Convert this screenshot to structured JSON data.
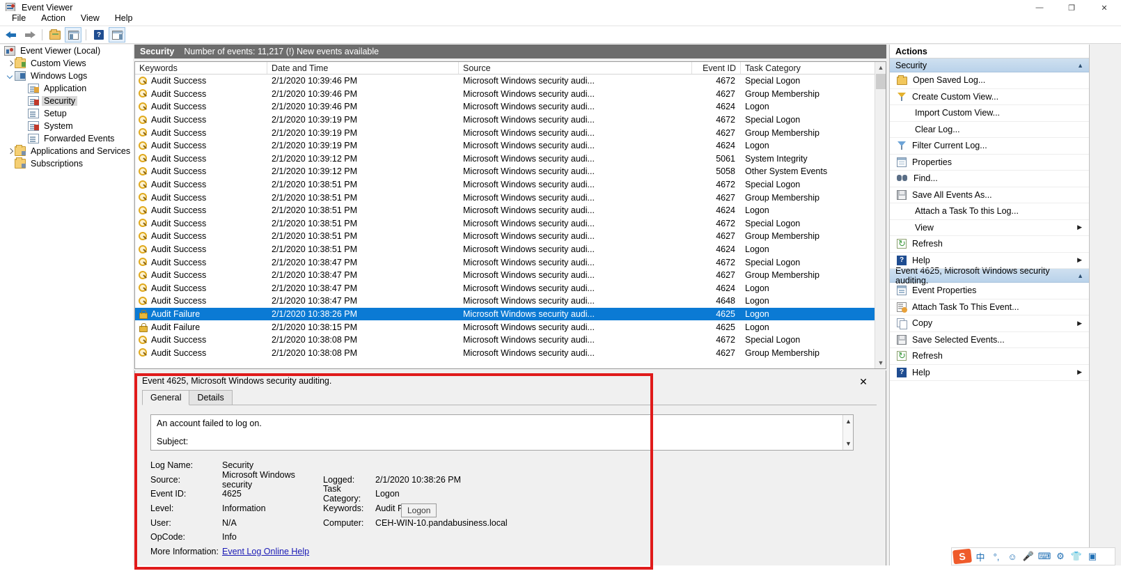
{
  "window": {
    "title": "Event Viewer",
    "app_icon": "event-viewer-icon",
    "minimize": "—",
    "maximize": "❐",
    "close": "✕"
  },
  "menu": {
    "items": [
      "File",
      "Action",
      "View",
      "Help"
    ]
  },
  "toolbar": {
    "items": [
      {
        "name": "back-button",
        "icon": "arrow-left-icon"
      },
      {
        "name": "forward-button",
        "icon": "arrow-right-icon"
      },
      {
        "name": "up-one-level-button",
        "icon": "folder-up-icon"
      },
      {
        "name": "show-hide-console-tree-button",
        "icon": "console-tree-icon"
      },
      {
        "name": "help-button",
        "icon": "help-question-icon"
      },
      {
        "name": "show-hide-action-pane-button",
        "icon": "action-pane-icon"
      }
    ]
  },
  "tree": {
    "root": {
      "label": "Event Viewer (Local)",
      "icon": "event-viewer-icon"
    },
    "items": [
      {
        "label": "Custom Views",
        "icon": "folder-icon",
        "expander": "right",
        "indent": 1
      },
      {
        "label": "Windows Logs",
        "icon": "computer-log-icon",
        "expander": "down",
        "indent": 1
      },
      {
        "label": "Application",
        "icon": "log-warn-icon",
        "expander": "none",
        "indent": 2
      },
      {
        "label": "Security",
        "icon": "log-red-icon",
        "expander": "none",
        "indent": 2,
        "selected": true
      },
      {
        "label": "Setup",
        "icon": "log-icon",
        "expander": "none",
        "indent": 2
      },
      {
        "label": "System",
        "icon": "log-red-icon",
        "expander": "none",
        "indent": 2
      },
      {
        "label": "Forwarded Events",
        "icon": "log-icon",
        "expander": "none",
        "indent": 2
      },
      {
        "label": "Applications and Services Lo",
        "icon": "folder-dots-icon",
        "expander": "right",
        "indent": 1
      },
      {
        "label": "Subscriptions",
        "icon": "folder-dots-icon",
        "expander": "none",
        "indent": 1
      }
    ]
  },
  "list": {
    "header_log_name": "Security",
    "header_status": "Number of events: 11,217 (!) New events available",
    "columns": [
      "Keywords",
      "Date and Time",
      "Source",
      "Event ID",
      "Task Category"
    ],
    "rows": [
      {
        "keyword": "Audit Success",
        "kind": "success",
        "datetime": "2/1/2020 10:39:46 PM",
        "source": "Microsoft Windows security audi...",
        "event_id": "4672",
        "task_category": "Special Logon"
      },
      {
        "keyword": "Audit Success",
        "kind": "success",
        "datetime": "2/1/2020 10:39:46 PM",
        "source": "Microsoft Windows security audi...",
        "event_id": "4627",
        "task_category": "Group Membership"
      },
      {
        "keyword": "Audit Success",
        "kind": "success",
        "datetime": "2/1/2020 10:39:46 PM",
        "source": "Microsoft Windows security audi...",
        "event_id": "4624",
        "task_category": "Logon"
      },
      {
        "keyword": "Audit Success",
        "kind": "success",
        "datetime": "2/1/2020 10:39:19 PM",
        "source": "Microsoft Windows security audi...",
        "event_id": "4672",
        "task_category": "Special Logon"
      },
      {
        "keyword": "Audit Success",
        "kind": "success",
        "datetime": "2/1/2020 10:39:19 PM",
        "source": "Microsoft Windows security audi...",
        "event_id": "4627",
        "task_category": "Group Membership"
      },
      {
        "keyword": "Audit Success",
        "kind": "success",
        "datetime": "2/1/2020 10:39:19 PM",
        "source": "Microsoft Windows security audi...",
        "event_id": "4624",
        "task_category": "Logon"
      },
      {
        "keyword": "Audit Success",
        "kind": "success",
        "datetime": "2/1/2020 10:39:12 PM",
        "source": "Microsoft Windows security audi...",
        "event_id": "5061",
        "task_category": "System Integrity"
      },
      {
        "keyword": "Audit Success",
        "kind": "success",
        "datetime": "2/1/2020 10:39:12 PM",
        "source": "Microsoft Windows security audi...",
        "event_id": "5058",
        "task_category": "Other System Events"
      },
      {
        "keyword": "Audit Success",
        "kind": "success",
        "datetime": "2/1/2020 10:38:51 PM",
        "source": "Microsoft Windows security audi...",
        "event_id": "4672",
        "task_category": "Special Logon"
      },
      {
        "keyword": "Audit Success",
        "kind": "success",
        "datetime": "2/1/2020 10:38:51 PM",
        "source": "Microsoft Windows security audi...",
        "event_id": "4627",
        "task_category": "Group Membership"
      },
      {
        "keyword": "Audit Success",
        "kind": "success",
        "datetime": "2/1/2020 10:38:51 PM",
        "source": "Microsoft Windows security audi...",
        "event_id": "4624",
        "task_category": "Logon"
      },
      {
        "keyword": "Audit Success",
        "kind": "success",
        "datetime": "2/1/2020 10:38:51 PM",
        "source": "Microsoft Windows security audi...",
        "event_id": "4672",
        "task_category": "Special Logon"
      },
      {
        "keyword": "Audit Success",
        "kind": "success",
        "datetime": "2/1/2020 10:38:51 PM",
        "source": "Microsoft Windows security audi...",
        "event_id": "4627",
        "task_category": "Group Membership"
      },
      {
        "keyword": "Audit Success",
        "kind": "success",
        "datetime": "2/1/2020 10:38:51 PM",
        "source": "Microsoft Windows security audi...",
        "event_id": "4624",
        "task_category": "Logon"
      },
      {
        "keyword": "Audit Success",
        "kind": "success",
        "datetime": "2/1/2020 10:38:47 PM",
        "source": "Microsoft Windows security audi...",
        "event_id": "4672",
        "task_category": "Special Logon"
      },
      {
        "keyword": "Audit Success",
        "kind": "success",
        "datetime": "2/1/2020 10:38:47 PM",
        "source": "Microsoft Windows security audi...",
        "event_id": "4627",
        "task_category": "Group Membership"
      },
      {
        "keyword": "Audit Success",
        "kind": "success",
        "datetime": "2/1/2020 10:38:47 PM",
        "source": "Microsoft Windows security audi...",
        "event_id": "4624",
        "task_category": "Logon"
      },
      {
        "keyword": "Audit Success",
        "kind": "success",
        "datetime": "2/1/2020 10:38:47 PM",
        "source": "Microsoft Windows security audi...",
        "event_id": "4648",
        "task_category": "Logon"
      },
      {
        "keyword": "Audit Failure",
        "kind": "failure",
        "datetime": "2/1/2020 10:38:26 PM",
        "source": "Microsoft Windows security audi...",
        "event_id": "4625",
        "task_category": "Logon",
        "selected": true
      },
      {
        "keyword": "Audit Failure",
        "kind": "failure",
        "datetime": "2/1/2020 10:38:15 PM",
        "source": "Microsoft Windows security audi...",
        "event_id": "4625",
        "task_category": "Logon"
      },
      {
        "keyword": "Audit Success",
        "kind": "success",
        "datetime": "2/1/2020 10:38:08 PM",
        "source": "Microsoft Windows security audi...",
        "event_id": "4672",
        "task_category": "Special Logon"
      },
      {
        "keyword": "Audit Success",
        "kind": "success",
        "datetime": "2/1/2020 10:38:08 PM",
        "source": "Microsoft Windows security audi...",
        "event_id": "4627",
        "task_category": "Group Membership"
      }
    ]
  },
  "detail": {
    "title": "Event 4625, Microsoft Windows security auditing.",
    "close_label": "✕",
    "tabs": [
      {
        "label": "General",
        "active": true
      },
      {
        "label": "Details",
        "active": false
      }
    ],
    "message_line1": "An account failed to log on.",
    "message_line2": "Subject:",
    "fields": [
      {
        "label1": "Log Name:",
        "value1": "Security",
        "label2": "",
        "value2": ""
      },
      {
        "label1": "Source:",
        "value1": "Microsoft Windows security",
        "label2": "Logged:",
        "value2": "2/1/2020 10:38:26 PM"
      },
      {
        "label1": "Event ID:",
        "value1": "4625",
        "label2": "Task Category:",
        "value2": "Logon"
      },
      {
        "label1": "Level:",
        "value1": "Information",
        "label2": "Keywords:",
        "value2": "Audit Failure"
      },
      {
        "label1": "User:",
        "value1": "N/A",
        "label2": "Computer:",
        "value2": "CEH-WIN-10.pandabusiness.local"
      },
      {
        "label1": "OpCode:",
        "value1": "Info",
        "label2": "",
        "value2": ""
      }
    ],
    "more_information_label": "More Information:",
    "more_information_link": "Event Log Online Help",
    "tooltip": "Logon"
  },
  "actions": {
    "header": "Actions",
    "group_log": {
      "title": "Security",
      "caret": "▲"
    },
    "log_items": [
      {
        "label": "Open Saved Log...",
        "icon": "open-saved-log-icon"
      },
      {
        "label": "Create Custom View...",
        "icon": "funnel-yellow-icon"
      },
      {
        "label": "Import Custom View...",
        "icon": "none"
      },
      {
        "label": "Clear Log...",
        "icon": "none"
      },
      {
        "label": "Filter Current Log...",
        "icon": "funnel-blue-icon"
      },
      {
        "label": "Properties",
        "icon": "properties-icon"
      },
      {
        "label": "Find...",
        "icon": "binoculars-icon"
      },
      {
        "label": "Save All Events As...",
        "icon": "save-icon"
      },
      {
        "label": "Attach a Task To this Log...",
        "icon": "none"
      },
      {
        "label": "View",
        "icon": "none",
        "submenu": "▶"
      },
      {
        "label": "Refresh",
        "icon": "refresh-icon"
      },
      {
        "label": "Help",
        "icon": "help-question-icon",
        "submenu": "▶"
      }
    ],
    "group_event": {
      "title": "Event 4625, Microsoft Windows security auditing.",
      "caret": "▲"
    },
    "event_items": [
      {
        "label": "Event Properties",
        "icon": "properties-icon"
      },
      {
        "label": "Attach Task To This Event...",
        "icon": "attach-task-icon"
      },
      {
        "label": "Copy",
        "icon": "copy-icon",
        "submenu": "▶"
      },
      {
        "label": "Save Selected Events...",
        "icon": "save-icon"
      },
      {
        "label": "Refresh",
        "icon": "refresh-icon"
      },
      {
        "label": "Help",
        "icon": "help-question-icon",
        "submenu": "▶"
      }
    ]
  },
  "ime": {
    "logo": "S",
    "items": [
      "中",
      "°,",
      "☺",
      "🎤",
      "⌨",
      "⚙",
      "👕",
      "▣"
    ]
  },
  "colors": {
    "selection_blue": "#0b7ad4",
    "status_bar_gray": "#6d6d6d",
    "annotation_red": "#e01b1b",
    "link_blue": "#1a1ab5"
  }
}
